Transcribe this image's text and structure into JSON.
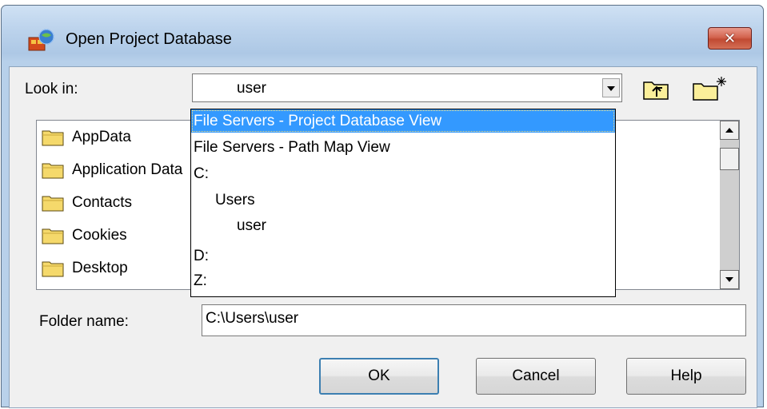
{
  "window": {
    "title": "Open Project Database",
    "close_symbol": "✕",
    "icon": "project-database-icon"
  },
  "look_in": {
    "label": "Look in:",
    "value": "user",
    "up_folder_icon": "up-one-level-icon",
    "new_folder_icon": "new-folder-icon"
  },
  "dropdown": {
    "items": [
      {
        "label": "File Servers - Project Database View",
        "indent": 0,
        "selected": true
      },
      {
        "label": "File Servers - Path Map View",
        "indent": 0,
        "selected": false
      },
      {
        "label": "C:",
        "indent": 0,
        "selected": false
      },
      {
        "label": "Users",
        "indent": 1,
        "selected": false
      },
      {
        "label": "user",
        "indent": 2,
        "selected": false
      },
      {
        "label": "D:",
        "indent": 0,
        "selected": false
      },
      {
        "label": "Z:",
        "indent": 0,
        "selected": false
      }
    ]
  },
  "folders": {
    "items": [
      "AppData",
      "Application Data",
      "Contacts",
      "Cookies",
      "Desktop"
    ]
  },
  "folder_name": {
    "label": "Folder name:",
    "value": "C:\\Users\\user"
  },
  "buttons": {
    "ok": "OK",
    "cancel": "Cancel",
    "help": "Help"
  },
  "colors": {
    "selection": "#3399ff",
    "folder": "#f5d96b",
    "close_button": "#c94b34"
  }
}
